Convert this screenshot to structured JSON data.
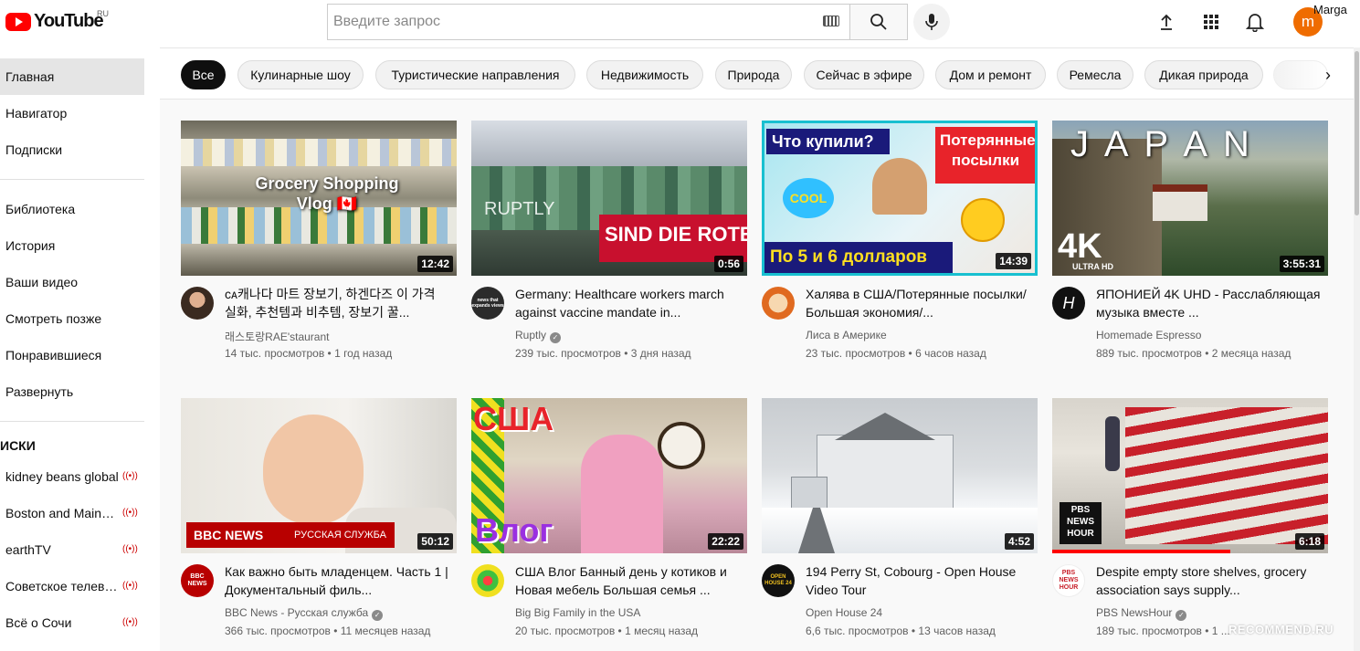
{
  "header": {
    "logo_text": "YouTube",
    "region": "RU",
    "search_placeholder": "Введите запрос",
    "user_initial": "m",
    "user_name": "Marga"
  },
  "sidebar": {
    "main": [
      {
        "label": "Главная"
      },
      {
        "label": "Навигатор"
      },
      {
        "label": "Подписки"
      }
    ],
    "library": [
      {
        "label": "Библиотека"
      },
      {
        "label": "История"
      },
      {
        "label": "Ваши видео"
      },
      {
        "label": "Смотреть позже"
      },
      {
        "label": "Понравившиеся"
      },
      {
        "label": "Развернуть"
      }
    ],
    "subs_header": "ИСКИ",
    "subscriptions": [
      {
        "label": "kidney beans global"
      },
      {
        "label": "Boston and Maine ..."
      },
      {
        "label": "earthTV"
      },
      {
        "label": "Советское телеви..."
      },
      {
        "label": "Всё о Сочи"
      }
    ],
    "live_icon": "((•))"
  },
  "chips": [
    "Все",
    "Кулинарные шоу",
    "Туристические направления",
    "Недвижимость",
    "Природа",
    "Сейчас в эфире",
    "Дом и ремонт",
    "Ремесла",
    "Дикая природа"
  ],
  "videos": [
    {
      "title": "ᴄᴀ캐나다 마트 장보기, 하겐다즈 이 가격 실화, 추천템과 비추템, 장보기 꿀...",
      "channel": "래스토랑RAE'staurant",
      "meta": "14 тыс. просмотров • 1 год назад",
      "duration": "12:42",
      "overlay": "Grocery Shopping Vlog 🇨🇦"
    },
    {
      "title": "Germany: Healthcare workers march against vaccine mandate in...",
      "channel": "Ruptly",
      "meta": "239 тыс. просмотров • 3 дня назад",
      "duration": "0:56",
      "overlay": "SIND DIE ROTE L",
      "overlay2": "RUPTLY",
      "avatar_text": "news that expands views"
    },
    {
      "title": "Халява в США/Потерянные посылки/Большая экономия/...",
      "channel": "Лиса в Америке",
      "meta": "23 тыс. просмотров • 6 часов назад",
      "duration": "14:39",
      "overlay": "Что купили?",
      "overlay2": "Потерянные посылки",
      "overlay3": "По 5 и 6 долларов",
      "overlay4": "COOL"
    },
    {
      "title": "ЯПОНИЕЙ 4K UHD - Расслабляющая музыка вместе ...",
      "channel": "Homemade Espresso",
      "meta": "889 тыс. просмотров • 2 месяца назад",
      "duration": "3:55:31",
      "overlay": "J A P A N",
      "overlay2": "4K",
      "overlay3": "ULTRA HD",
      "avatar_text": "H"
    },
    {
      "title": "Как важно быть младенцем. Часть 1 | Документальный филь...",
      "channel": "BBC News - Русская служба",
      "meta": "366 тыс. просмотров • 11 месяцев назад",
      "duration": "50:12",
      "overlay": "BBC NEWS",
      "overlay2": "РУССКАЯ СЛУЖБА",
      "avatar_text": "BBC NEWS"
    },
    {
      "title": "США Влог Банный день у котиков и Новая мебель Большая семья ...",
      "channel": "Big Big Family in the USA",
      "meta": "20 тыс. просмотров • 1 месяц назад",
      "duration": "22:22",
      "overlay": "США",
      "overlay2": "Влог"
    },
    {
      "title": "194 Perry St, Cobourg - Open House Video Tour",
      "channel": "Open House 24",
      "meta": "6,6 тыс. просмотров • 13 часов назад",
      "duration": "4:52",
      "avatar_text": "OPEN HOUSE 24"
    },
    {
      "title": "Despite empty store shelves, grocery association says supply...",
      "channel": "PBS NewsHour",
      "meta": "189 тыс. просмотров • 1 ...",
      "duration": "6:18",
      "overlay": "PBS NEWS HOUR",
      "avatar_text": "PBS NEWS HOUR"
    }
  ],
  "watermark": "RECOMMEND.RU",
  "colors": {
    "brand": "#ff0000",
    "avatar": "#ef6c00",
    "chip_active": "#0f0f0f"
  }
}
